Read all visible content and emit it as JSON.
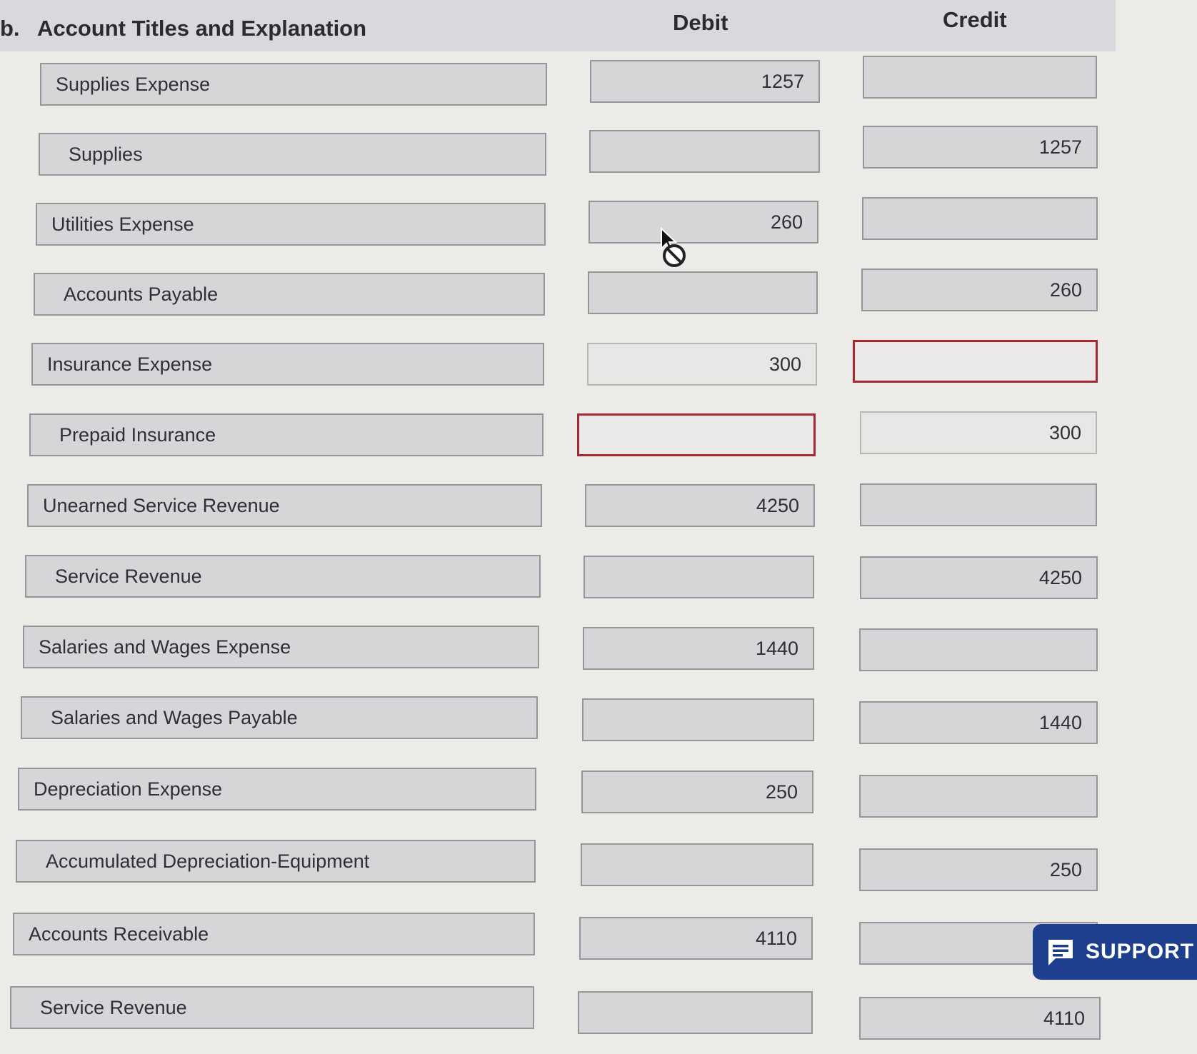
{
  "header": {
    "part_label": "b.",
    "account_column": "Account Titles and Explanation",
    "debit_column": "Debit",
    "credit_column": "Credit"
  },
  "rows": [
    {
      "account": "Supplies Expense",
      "debit": "1257",
      "credit": ""
    },
    {
      "account": "Supplies",
      "debit": "",
      "credit": "1257"
    },
    {
      "account": "Utilities Expense",
      "debit": "260",
      "credit": ""
    },
    {
      "account": "Accounts Payable",
      "debit": "",
      "credit": "260"
    },
    {
      "account": "Insurance Expense",
      "debit": "300",
      "credit": ""
    },
    {
      "account": "Prepaid Insurance",
      "debit": "",
      "credit": "300"
    },
    {
      "account": "Unearned Service Revenue",
      "debit": "4250",
      "credit": ""
    },
    {
      "account": "Service Revenue",
      "debit": "",
      "credit": "4250"
    },
    {
      "account": "Salaries and Wages Expense",
      "debit": "1440",
      "credit": ""
    },
    {
      "account": "Salaries and Wages Payable",
      "debit": "",
      "credit": "1440"
    },
    {
      "account": "Depreciation Expense",
      "debit": "250",
      "credit": ""
    },
    {
      "account": "Accumulated Depreciation-Equipment",
      "debit": "",
      "credit": "250"
    },
    {
      "account": "Accounts Receivable",
      "debit": "4110",
      "credit": ""
    },
    {
      "account": "Service Revenue",
      "debit": "",
      "credit": "4110"
    }
  ],
  "support": {
    "label": "SUPPORT",
    "icon": "chat-icon",
    "color": "#1e3f8e"
  },
  "colors": {
    "error_border": "#a32a30",
    "field_background": "#d6d5d8"
  },
  "icons": {
    "cursor": "arrow-cursor-icon",
    "not_allowed": "not-allowed-icon"
  }
}
